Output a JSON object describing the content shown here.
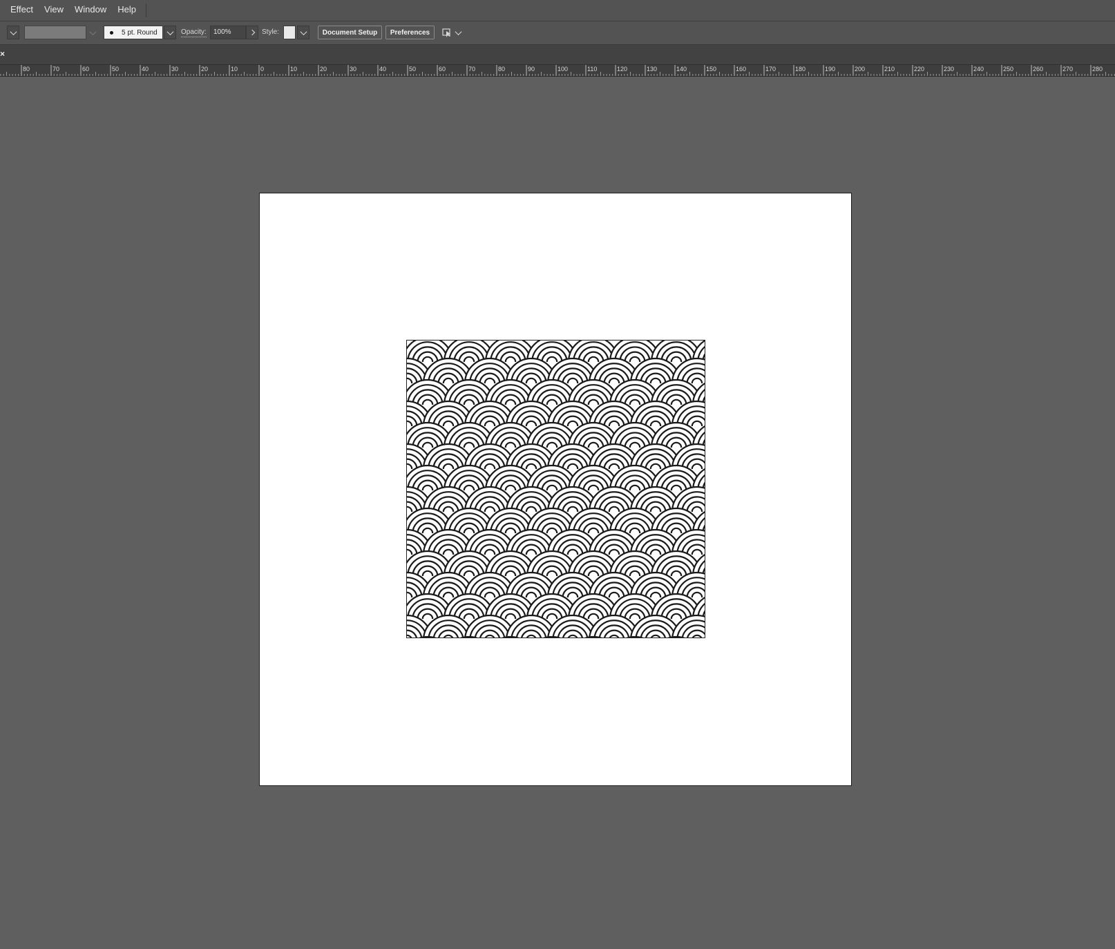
{
  "menubar": {
    "items": [
      "Effect",
      "View",
      "Window",
      "Help"
    ]
  },
  "controlbar": {
    "stroke_weight": "5 pt. Round",
    "opacity_label": "Opacity:",
    "opacity_value": "100%",
    "style_label": "Style:",
    "document_setup": "Document Setup",
    "preferences": "Preferences"
  },
  "tabstrip": {
    "close_glyph": "×"
  },
  "ruler": {
    "labels": [
      "80",
      "70",
      "60",
      "50",
      "40",
      "30",
      "20",
      "10",
      "0",
      "10",
      "20",
      "30",
      "40",
      "50",
      "60",
      "70",
      "80",
      "90",
      "100",
      "110",
      "120",
      "130",
      "140",
      "150",
      "160",
      "170",
      "180",
      "190",
      "200",
      "210",
      "220",
      "230",
      "240",
      "250",
      "260",
      "270",
      "280"
    ]
  },
  "canvas": {
    "background": "#5f5f5f",
    "artboard_color": "#ffffff",
    "pattern_name": "seigaiha-wave-pattern",
    "stroke_color": "#1a1a1a"
  }
}
